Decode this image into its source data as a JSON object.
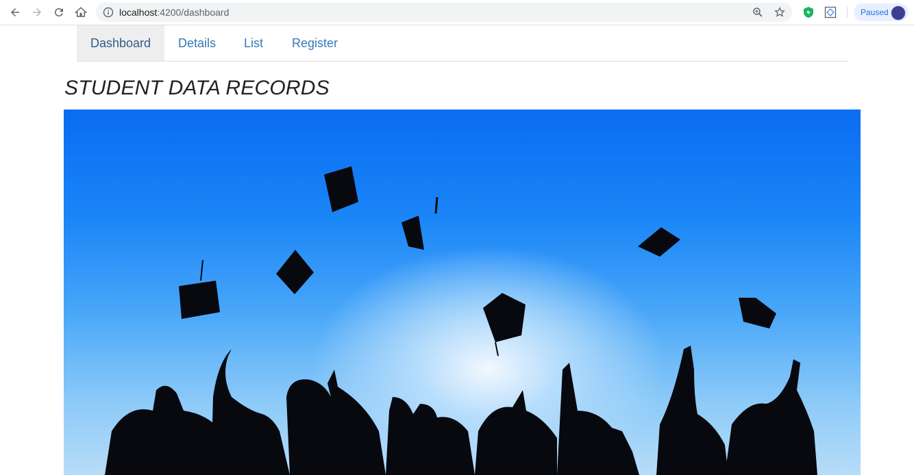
{
  "browser": {
    "url_host": "localhost",
    "url_rest": ":4200/dashboard",
    "profile_status": "Paused"
  },
  "nav": {
    "tabs": [
      {
        "label": "Dashboard",
        "active": true
      },
      {
        "label": "Details",
        "active": false
      },
      {
        "label": "List",
        "active": false
      },
      {
        "label": "Register",
        "active": false
      }
    ]
  },
  "page": {
    "title": "STUDENT DATA RECORDS"
  },
  "hero_image": {
    "description_icon": "graduation-caps-photo"
  }
}
